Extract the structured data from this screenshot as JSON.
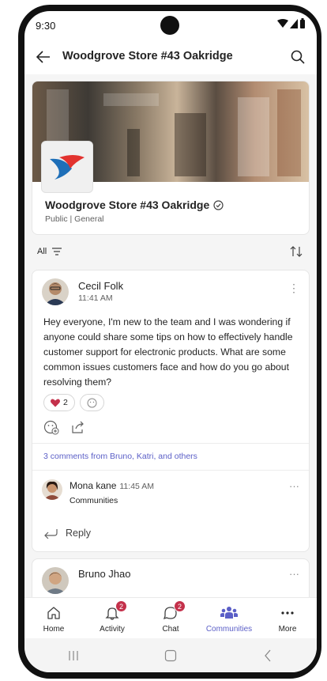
{
  "status_bar": {
    "time": "9:30"
  },
  "app_bar": {
    "title": "Woodgrove Store #43 Oakridge"
  },
  "team": {
    "name": "Woodgrove Store #43 Oakridge",
    "subtitle": "Public | General"
  },
  "filter": {
    "label": "All"
  },
  "post": {
    "author": "Cecil Folk",
    "time": "11:41 AM",
    "body": "Hey everyone, I'm new to the team and I was wondering if anyone could share some tips on how to effectively handle customer support for electronic products. What are some common issues customers face and how do you go about resolving them?",
    "reaction_count": "2",
    "comments_summary": "3 comments from Bruno, Katri, and others",
    "reply": {
      "author": "Mona kane",
      "time": "11:45 AM",
      "text": "Communities"
    },
    "reply_label": "Reply"
  },
  "post2": {
    "author": "Bruno Jhao"
  },
  "tabs": [
    {
      "label": "Home",
      "icon": "home-icon",
      "badge": ""
    },
    {
      "label": "Activity",
      "icon": "bell-icon",
      "badge": "2"
    },
    {
      "label": "Chat",
      "icon": "chat-icon",
      "badge": "2"
    },
    {
      "label": "Communities",
      "icon": "communities-icon",
      "badge": "",
      "active": true
    },
    {
      "label": "More",
      "icon": "more-icon",
      "badge": ""
    }
  ],
  "colors": {
    "accent": "#5b5fc7",
    "badge": "#c4314b",
    "heart": "#c4314b"
  }
}
